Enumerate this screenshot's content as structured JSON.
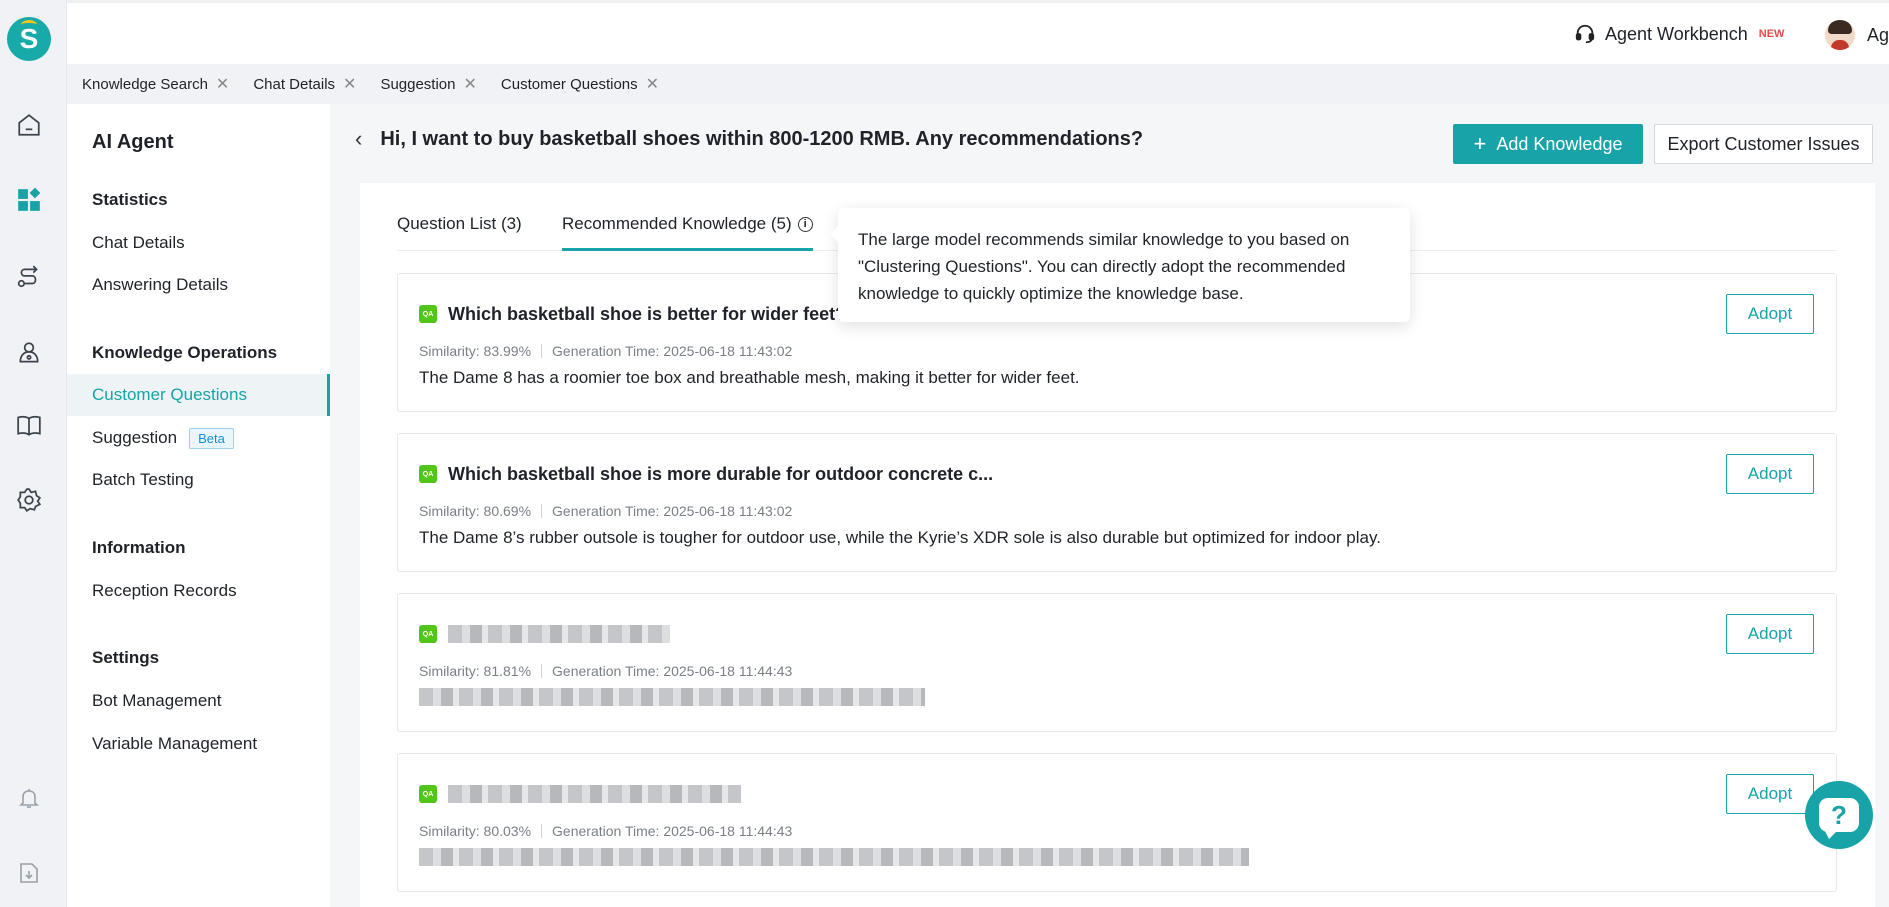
{
  "header": {
    "workbench_label": "Agent Workbench",
    "workbench_badge": "NEW",
    "user_name": "Agent"
  },
  "tabstrip": [
    {
      "label": "Knowledge Search"
    },
    {
      "label": "Chat Details"
    },
    {
      "label": "Suggestion"
    },
    {
      "label": "Customer Questions"
    }
  ],
  "sidebar": {
    "title": "AI Agent",
    "sections": {
      "statistics": "Statistics",
      "knowledge_ops": "Knowledge Operations",
      "information": "Information",
      "settings": "Settings"
    },
    "items": {
      "chat_details": "Chat Details",
      "answering_details": "Answering Details",
      "customer_questions": "Customer Questions",
      "suggestion": "Suggestion",
      "suggestion_badge": "Beta",
      "batch_testing": "Batch Testing",
      "reception_records": "Reception Records",
      "bot_management": "Bot Management",
      "variable_management": "Variable Management"
    }
  },
  "main": {
    "question": "Hi, I want to buy basketball shoes within 800-1200 RMB. Any recommendations?",
    "add_knowledge": "Add Knowledge",
    "export_issues": "Export Customer Issues",
    "tabs": {
      "question_list": "Question List (3)",
      "recommended": "Recommended Knowledge (5)"
    },
    "tooltip": "The large model recommends similar knowledge to you based on \"Clustering Questions\". You can directly adopt the recommended knowledge to quickly optimize the knowledge base.",
    "adopt_label": "Adopt",
    "qa_icon": "QA",
    "cards": [
      {
        "title": "Which basketball shoe is better for wider feet?",
        "similarity": "Similarity: 83.99%",
        "gen_time": "Generation Time: 2025-06-18 11:43:02",
        "answer": "The Dame 8 has a roomier toe box and breathable mesh, making it better for wider feet."
      },
      {
        "title": "Which basketball shoe is more durable for outdoor concrete c...",
        "similarity": "Similarity: 80.69%",
        "gen_time": "Generation Time: 2025-06-18 11:43:02",
        "answer": "The Dame 8’s rubber outsole is tougher for outdoor use, while the Kyrie’s XDR sole is also durable but optimized for indoor play."
      },
      {
        "title": "",
        "similarity": "Similarity: 81.81%",
        "gen_time": "Generation Time: 2025-06-18 11:44:43",
        "answer": ""
      },
      {
        "title": "",
        "similarity": "Similarity: 80.03%",
        "gen_time": "Generation Time: 2025-06-18 11:44:43",
        "answer": ""
      }
    ]
  },
  "colors": {
    "accent": "#18a3a8",
    "qa_green": "#52c41a",
    "new_badge": "#e84d4d"
  },
  "icons": {
    "rail": [
      "home-icon",
      "dashboard-icon",
      "routing-icon",
      "user-location-icon",
      "book-icon",
      "settings-icon",
      "bell-icon",
      "download-icon"
    ],
    "help": "help-chat-icon"
  }
}
